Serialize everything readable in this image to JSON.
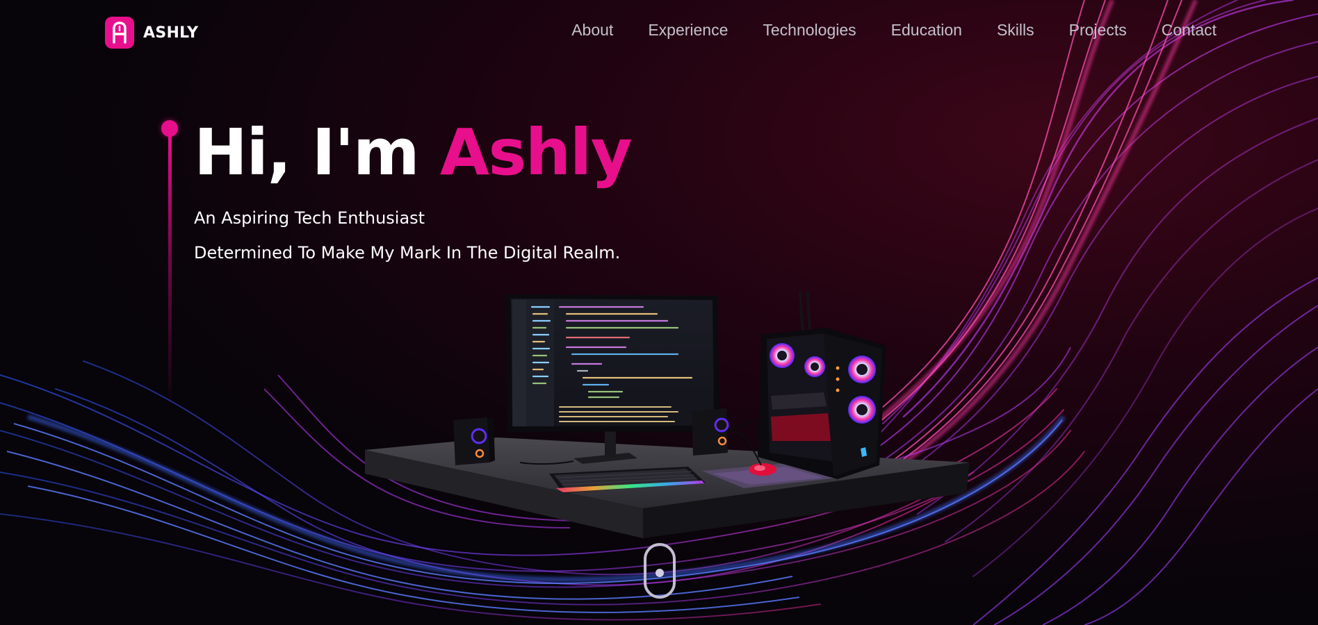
{
  "brand": {
    "name": "ASHLY",
    "accent": "#e80f8c",
    "icon": "stylized-letter-a-icon"
  },
  "nav": {
    "items": [
      {
        "label": "About"
      },
      {
        "label": "Experience"
      },
      {
        "label": "Technologies"
      },
      {
        "label": "Education"
      },
      {
        "label": "Skills"
      },
      {
        "label": "Projects"
      },
      {
        "label": "Contact"
      }
    ]
  },
  "hero": {
    "greeting": "Hi, I'm ",
    "name": "Ashly",
    "line1": "An Aspiring Tech Enthusiast",
    "line2": "Determined To Make My Mark In The Digital Realm."
  },
  "scene": {
    "description_icon": "gaming-desk-setup-illustration"
  },
  "scroll": {
    "icon": "mouse-scroll-icon"
  },
  "colors": {
    "background": "#07040a",
    "text": "#ffffff",
    "nav_text": "#c4c1cc",
    "wave_pink": "#ff2e9a",
    "wave_purple": "#8b3dff",
    "wave_blue": "#3a5bff"
  }
}
